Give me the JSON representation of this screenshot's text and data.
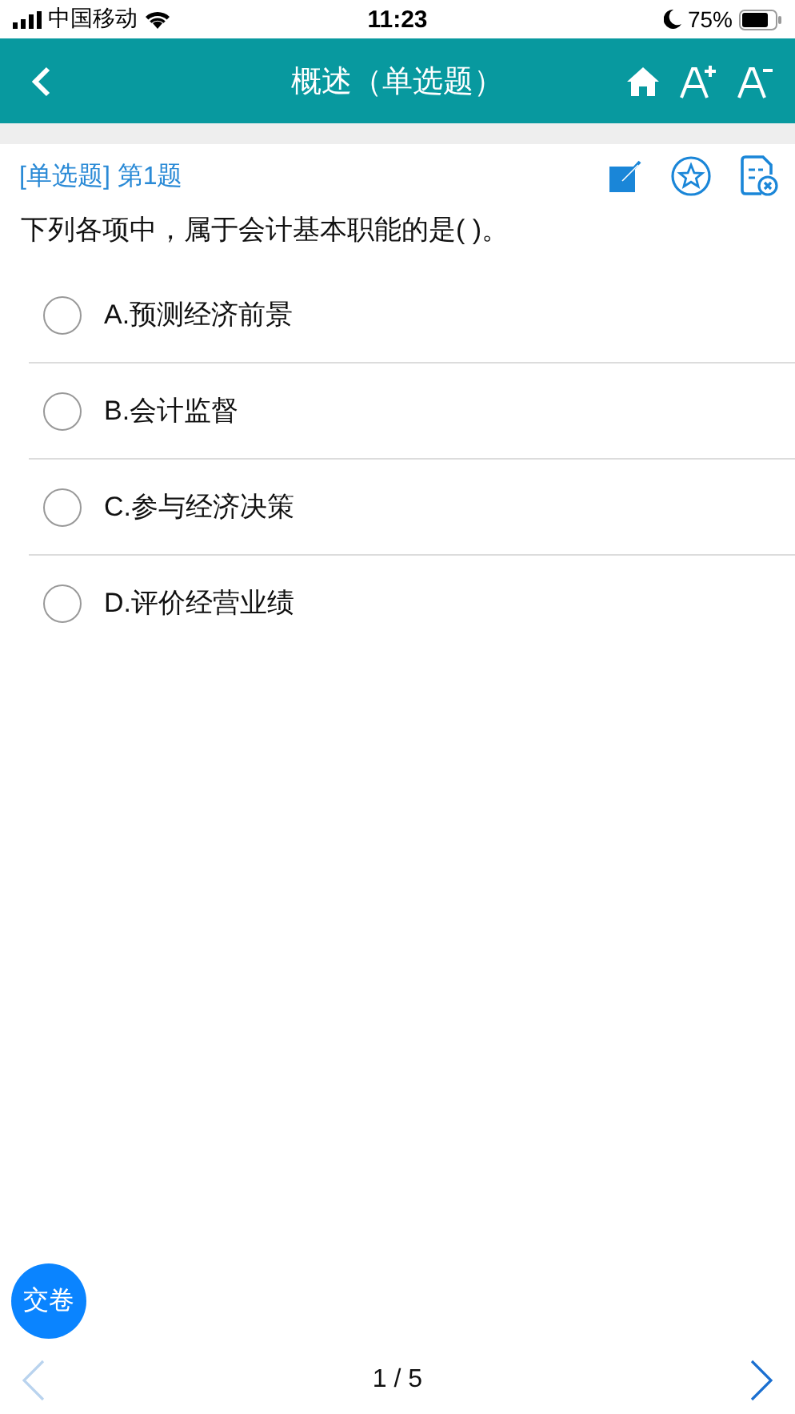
{
  "status_bar": {
    "carrier": "中国移动",
    "time": "11:23",
    "battery": "75%"
  },
  "header": {
    "title": "概述（单选题）"
  },
  "question": {
    "type_label": "[单选题] 第1题",
    "text": "下列各项中，属于会计基本职能的是( )。",
    "options": [
      {
        "label": "A.预测经济前景",
        "selected": false
      },
      {
        "label": "B.会计监督",
        "selected": false
      },
      {
        "label": "C.参与经济决策",
        "selected": false
      },
      {
        "label": "D.评价经营业绩",
        "selected": false
      }
    ]
  },
  "submit_button": "交卷",
  "pager": {
    "text": "1 / 5",
    "prev_disabled": true,
    "next_disabled": false
  }
}
